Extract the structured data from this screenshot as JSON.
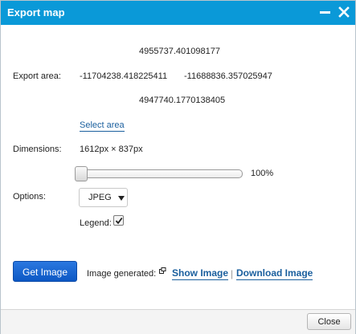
{
  "window": {
    "title": "Export map",
    "minimize_icon": "minimize-icon",
    "close_icon": "close-icon",
    "titlebar_color": "#0a99d8"
  },
  "export_area": {
    "label": "Export area:",
    "top": "4955737.401098177",
    "left": "-11704238.418225411",
    "right": "-11688836.357025947",
    "bottom": "4947740.1770138405",
    "select_area_link": "Select area"
  },
  "dimensions": {
    "label": "Dimensions:",
    "value": "1612px × 837px",
    "scale_percent": "100%",
    "slider_level": 0
  },
  "options": {
    "label": "Options:",
    "format_selected": "JPEG",
    "legend_label": "Legend:",
    "legend_checked": true
  },
  "actions": {
    "get_image_label": "Get Image",
    "image_generated_label": "Image generated:",
    "show_image_label": "Show Image",
    "separator": "|",
    "download_image_label": "Download Image",
    "primary_color": "#0d58c4"
  },
  "footer": {
    "close_label": "Close"
  }
}
